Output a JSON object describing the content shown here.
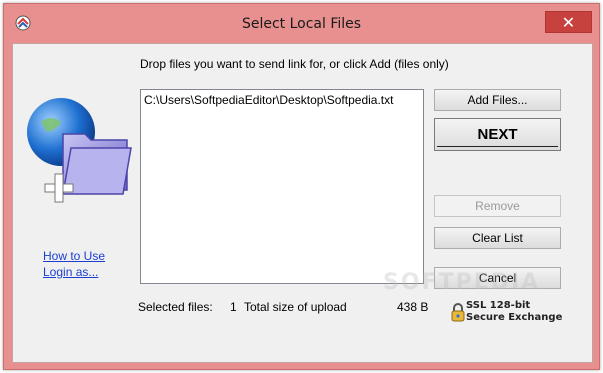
{
  "window": {
    "title": "Select Local Files",
    "close_glyph": "✕"
  },
  "main": {
    "drop_label": "Drop files you want to send link for, or click Add (files only)",
    "files": [
      "C:\\Users\\SoftpediaEditor\\Desktop\\Softpedia.txt"
    ]
  },
  "buttons": {
    "add_files": "Add Files...",
    "next": "NEXT",
    "remove": "Remove",
    "clear_list": "Clear List",
    "cancel": "Cancel"
  },
  "links": {
    "how_to_use": "How to Use",
    "login_as": "Login as..."
  },
  "status": {
    "selected_files_label": "Selected files:",
    "selected_files_count": "1",
    "total_size_label": "Total size of upload",
    "total_size_value": "438 B"
  },
  "ssl": {
    "line1": "SSL 128-bit",
    "line2": "Secure Exchange"
  },
  "watermark": "SOFTPEDIA",
  "colors": {
    "window_frame": "#e7908f",
    "close_button": "#c7423e",
    "link": "#1a3fd0"
  },
  "icons": [
    "app-icon",
    "close-icon",
    "globe-folder-add-icon",
    "lock-icon"
  ]
}
